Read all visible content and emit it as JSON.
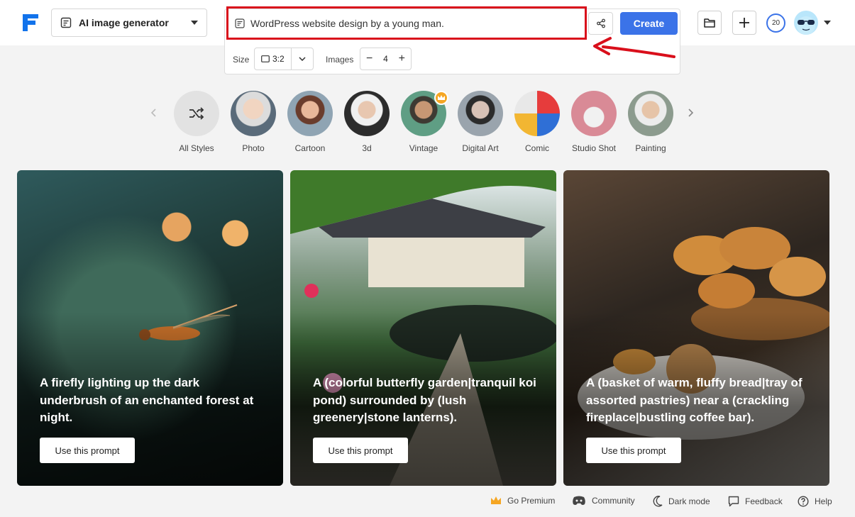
{
  "header": {
    "tool_select_label": "AI image generator",
    "prompt_text": "WordPress website design by a young man.",
    "create_label": "Create",
    "size_label": "Size",
    "size_value": "3:2",
    "images_label": "Images",
    "images_count": "4",
    "credits": "20"
  },
  "styles": [
    {
      "name": "All Styles"
    },
    {
      "name": "Photo"
    },
    {
      "name": "Cartoon"
    },
    {
      "name": "3d"
    },
    {
      "name": "Vintage"
    },
    {
      "name": "Digital Art"
    },
    {
      "name": "Comic"
    },
    {
      "name": "Studio Shot"
    },
    {
      "name": "Painting"
    }
  ],
  "cards": [
    {
      "text": "A firefly lighting up the dark underbrush of an enchanted forest at night.",
      "button": "Use this prompt"
    },
    {
      "text": "A (colorful butterfly garden|tranquil koi pond) surrounded by (lush greenery|stone lanterns).",
      "button": "Use this prompt"
    },
    {
      "text": "A (basket of warm, fluffy bread|tray of assorted pastries) near a (crackling fireplace|bustling coffee bar).",
      "button": "Use this prompt"
    }
  ],
  "footer": {
    "premium": "Go Premium",
    "community": "Community",
    "dark_mode": "Dark mode",
    "feedback": "Feedback",
    "help": "Help"
  },
  "colors": {
    "accent": "#3b73e8",
    "highlight_box": "#d90f1b",
    "premium": "#f5a623"
  }
}
